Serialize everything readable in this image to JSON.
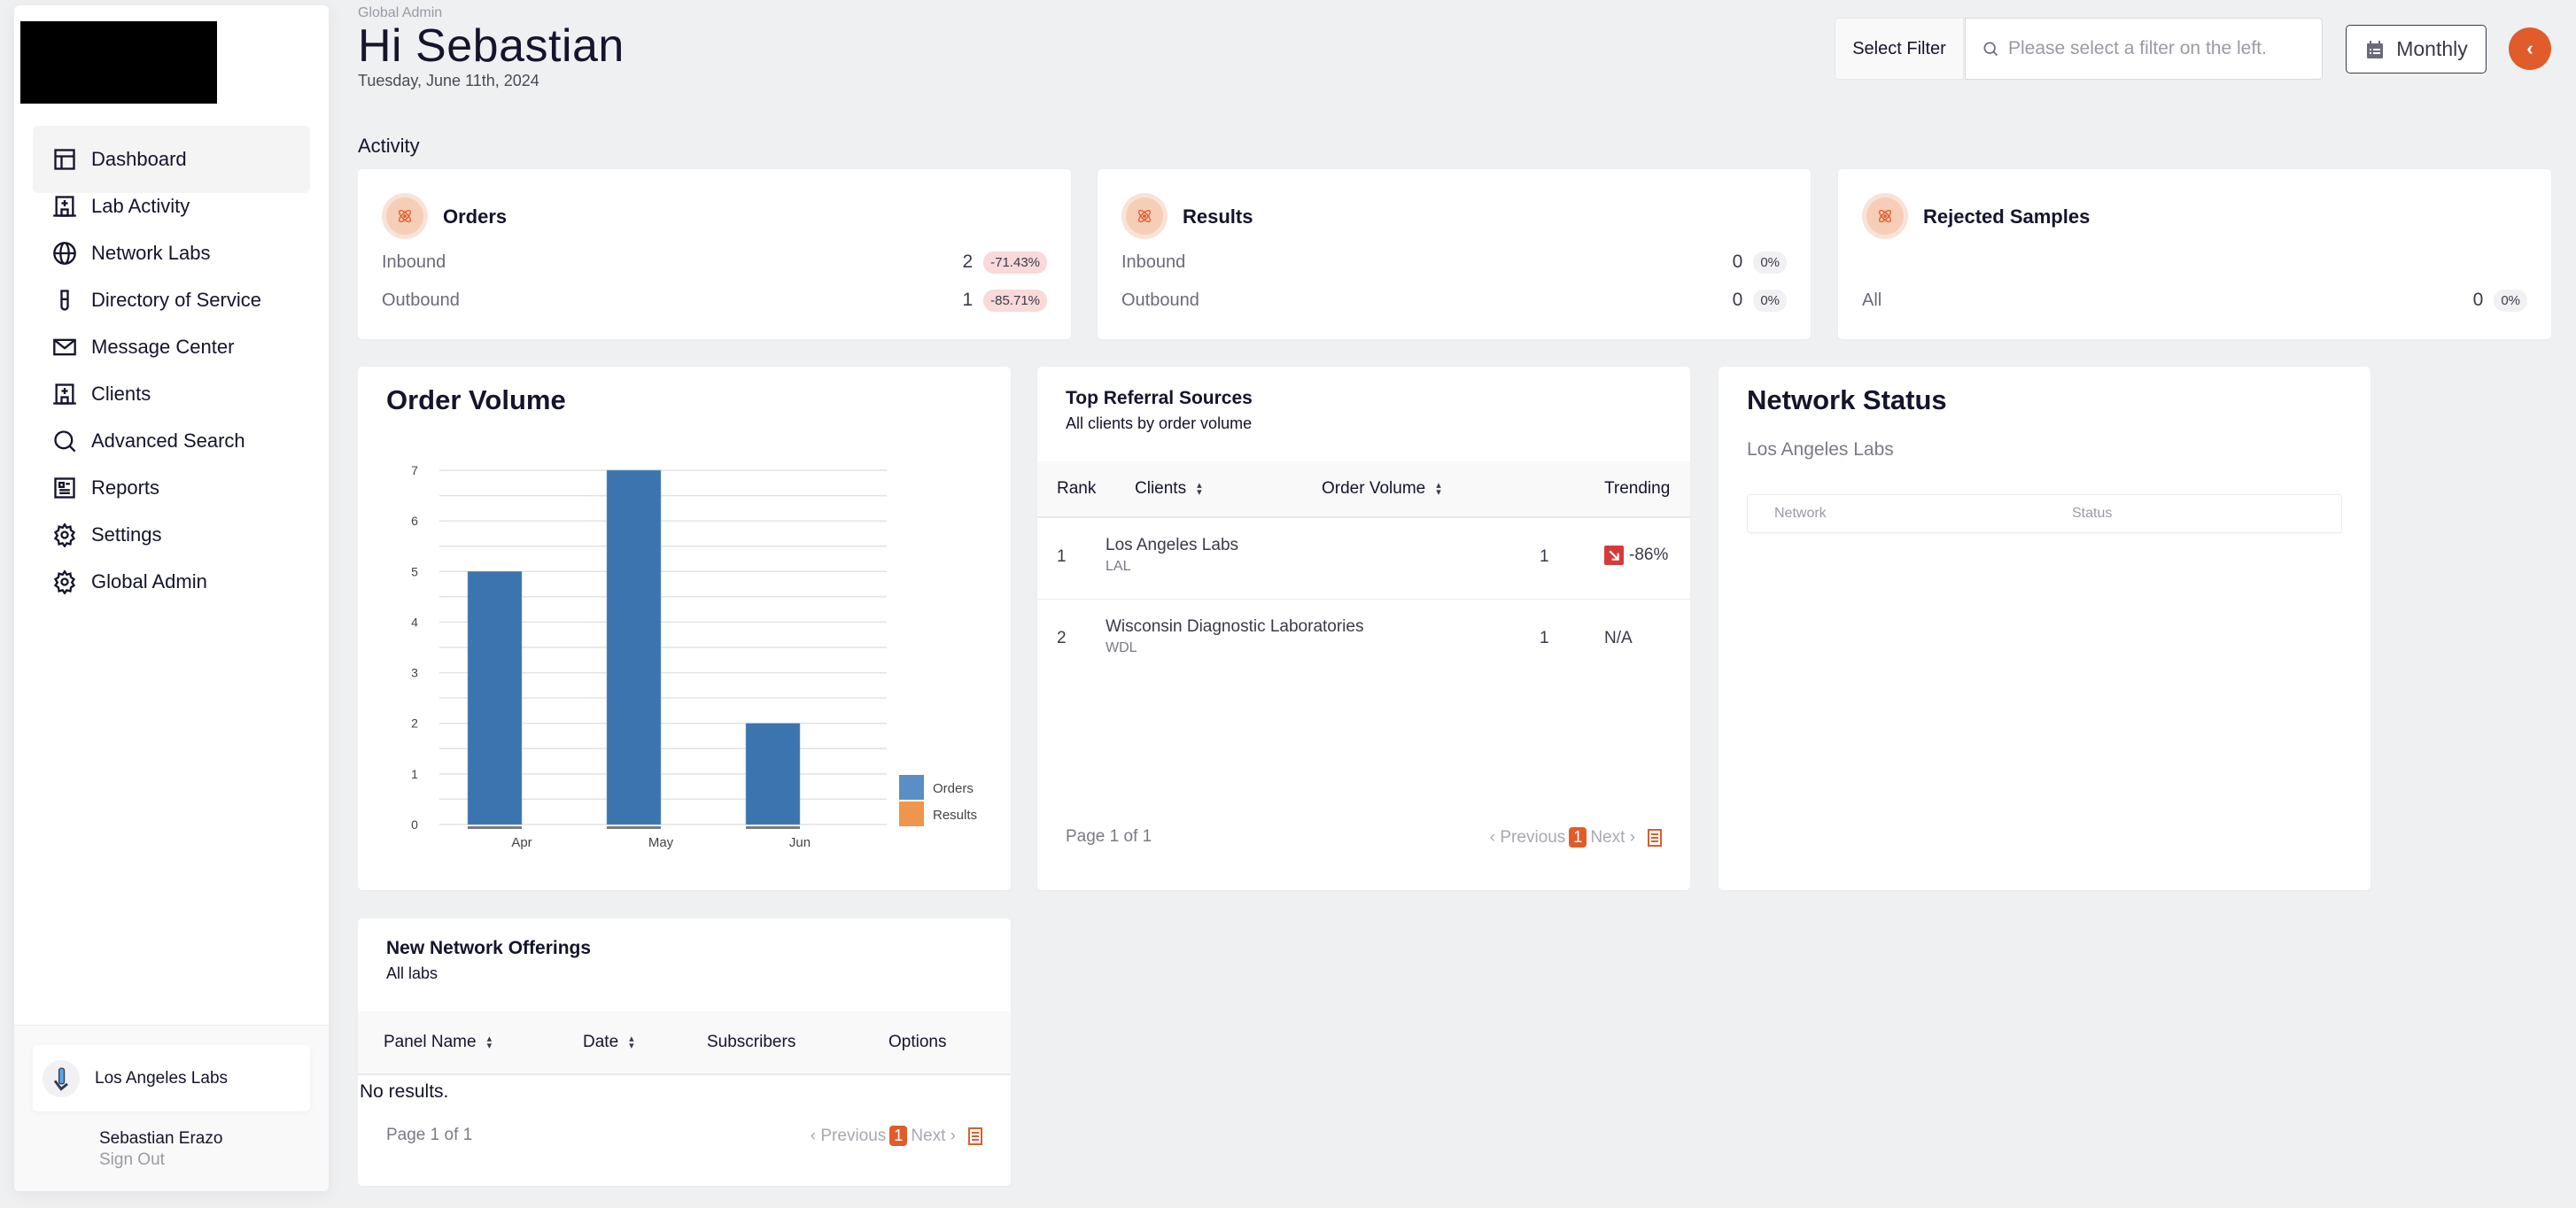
{
  "sidebar": {
    "items": [
      {
        "label": "Dashboard",
        "icon": "dashboard-icon",
        "active": true
      },
      {
        "label": "Lab Activity",
        "icon": "hospital-icon"
      },
      {
        "label": "Network Labs",
        "icon": "globe-icon"
      },
      {
        "label": "Directory of Service",
        "icon": "test-tube-icon"
      },
      {
        "label": "Message Center",
        "icon": "mail-icon"
      },
      {
        "label": "Clients",
        "icon": "hospital-icon"
      },
      {
        "label": "Advanced Search",
        "icon": "search-icon"
      },
      {
        "label": "Reports",
        "icon": "report-icon"
      },
      {
        "label": "Settings",
        "icon": "gear-icon"
      },
      {
        "label": "Global Admin",
        "icon": "gear-icon"
      }
    ],
    "org_name": "Los Angeles Labs",
    "user_name": "Sebastian Erazo",
    "sign_out": "Sign Out"
  },
  "header": {
    "breadcrumb": "Global Admin",
    "greeting": "Hi Sebastian",
    "date": "Tuesday, June 11th, 2024",
    "filter_label": "Select Filter",
    "filter_placeholder": "Please select a filter on the left.",
    "period": "Monthly",
    "accent": "#e05c2a"
  },
  "activity": {
    "label": "Activity",
    "cards": [
      {
        "title": "Orders",
        "rows": [
          {
            "label": "Inbound",
            "value": "2",
            "change": "-71.43%",
            "tone": "neg"
          },
          {
            "label": "Outbound",
            "value": "1",
            "change": "-85.71%",
            "tone": "neg"
          }
        ]
      },
      {
        "title": "Results",
        "rows": [
          {
            "label": "Inbound",
            "value": "0",
            "change": "0%",
            "tone": "neu"
          },
          {
            "label": "Outbound",
            "value": "0",
            "change": "0%",
            "tone": "neu"
          }
        ]
      },
      {
        "title": "Rejected Samples",
        "rows": [
          {
            "label": "All",
            "value": "0",
            "change": "0%",
            "tone": "neu"
          }
        ]
      }
    ]
  },
  "order_volume": {
    "title": "Order Volume"
  },
  "chart_data": {
    "type": "bar",
    "title": "Order Volume",
    "categories": [
      "Apr",
      "May",
      "Jun"
    ],
    "series": [
      {
        "name": "Orders",
        "values": [
          5,
          7,
          2
        ],
        "color": "#3b74ae"
      },
      {
        "name": "Results",
        "values": [
          0,
          0,
          0
        ],
        "color": "#f0954e"
      }
    ],
    "yticks": [
      0,
      1,
      2,
      3,
      4,
      5,
      6,
      7
    ],
    "ylim": [
      0,
      7
    ],
    "xlabel": "",
    "ylabel": "",
    "grid": true,
    "legend": "bottom-right"
  },
  "referrals": {
    "title": "Top Referral Sources",
    "subtitle": "All clients by order volume",
    "columns": [
      "Rank",
      "Clients",
      "Order Volume",
      "Trending"
    ],
    "rows": [
      {
        "rank": "1",
        "name": "Los Angeles Labs",
        "code": "LAL",
        "volume": "1",
        "trend": "-86%",
        "trend_down": true
      },
      {
        "rank": "2",
        "name": "Wisconsin Diagnostic Laboratories",
        "code": "WDL",
        "volume": "1",
        "trend": "N/A",
        "trend_down": false
      }
    ],
    "pager": {
      "text": "Page 1 of 1",
      "prev": "‹ Previous",
      "current": "1",
      "next": "Next ›"
    }
  },
  "network_status": {
    "title": "Network Status",
    "lab": "Los Angeles Labs",
    "columns": [
      "Network",
      "Status"
    ]
  },
  "offerings": {
    "title": "New Network Offerings",
    "subtitle": "All labs",
    "columns": [
      "Panel Name",
      "Date",
      "Subscribers",
      "Options"
    ],
    "empty": "No results.",
    "pager": {
      "text": "Page 1 of 1",
      "prev": "‹ Previous",
      "current": "1",
      "next": "Next ›"
    }
  }
}
